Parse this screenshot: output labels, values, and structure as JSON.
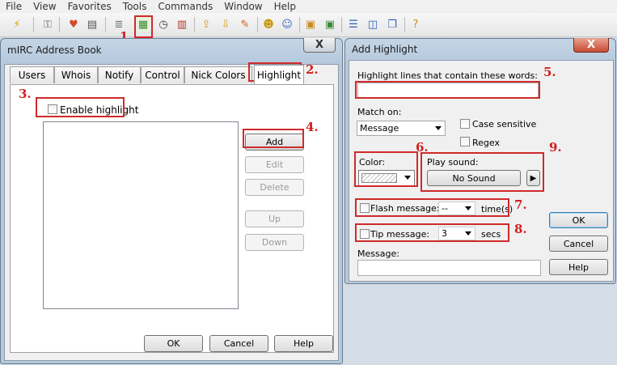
{
  "menu": [
    "File",
    "View",
    "Favorites",
    "Tools",
    "Commands",
    "Window",
    "Help"
  ],
  "toolbar_icons": [
    "connect-icon",
    "options-icon",
    "favorites-icon",
    "perform-icon",
    "channels-list-icon",
    "address-book-icon",
    "timer-icon",
    "colors-icon",
    "send-file-icon",
    "receive-file-icon",
    "dcc-chat-icon",
    "notify-icon",
    "finger-icon",
    "log-icon",
    "received-files-icon",
    "tile-vertical-icon",
    "tile-horizontal-icon",
    "cascade-icon",
    "help-icon"
  ],
  "address_book": {
    "title": "mIRC Address Book",
    "close": "X",
    "tabs": [
      "Users",
      "Whois",
      "Notify",
      "Control",
      "Nick Colors",
      "Highlight"
    ],
    "enable_highlight": "Enable highlight",
    "buttons": {
      "add": "Add",
      "edit": "Edit",
      "delete": "Delete",
      "up": "Up",
      "down": "Down"
    },
    "bottom": {
      "ok": "OK",
      "cancel": "Cancel",
      "help": "Help"
    }
  },
  "add_highlight": {
    "title": "Add Highlight",
    "close": "X",
    "words_label": "Highlight lines that contain these words:",
    "words_value": "",
    "match_on_label": "Match on:",
    "match_on_value": "Message",
    "case_sensitive": "Case sensitive",
    "regex": "Regex",
    "color_label": "Color:",
    "play_sound_label": "Play sound:",
    "no_sound": "No Sound",
    "play_glyph": "▶",
    "flash_label": "Flash message:",
    "flash_value": "--",
    "flash_unit": "time(s)",
    "tip_label": "Tip message:",
    "tip_value": "3",
    "tip_unit": "secs",
    "message_label": "Message:",
    "buttons": {
      "ok": "OK",
      "cancel": "Cancel",
      "help": "Help"
    }
  },
  "annotations": [
    "1.",
    "2.",
    "3.",
    "4.",
    "5.",
    "6.",
    "7.",
    "8.",
    "9."
  ],
  "colors": {
    "annotation": "#cf2a2a",
    "window_frame": "#b6c9dd",
    "panel": "#f0f0f0"
  }
}
